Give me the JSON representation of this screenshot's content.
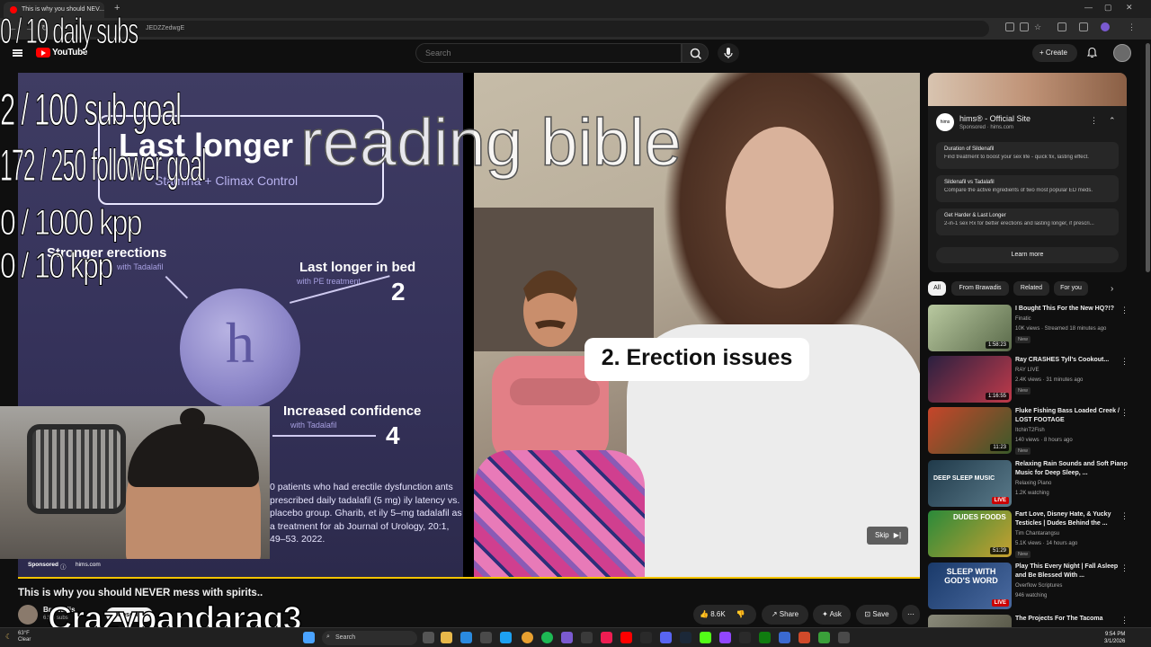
{
  "browser": {
    "tab_title": "This is why you should NEV...",
    "new_tab": "+",
    "url_fragment": "JEDZZedwgE"
  },
  "youtube": {
    "logo_text": "YouTube",
    "search_placeholder": "Search",
    "create_label": "Create"
  },
  "video": {
    "slide_title": "Last longer",
    "slide_subtitle": "Stamina + Climax Control",
    "label_1": "Stronger erections",
    "label_1_sub": "with Tadalafil",
    "label_2": "Last longer in bed",
    "label_2_sub": "with PE treatment",
    "label_2_num": "2",
    "label_3": "Increased confidence",
    "label_3_sub": "with Tadalafil",
    "label_3_num": "4",
    "pill_letter": "h",
    "disclaimer": "0 patients who had erectile dysfunction ants prescribed daily tadalafil (5 mg) ily latency vs. placebo group. Gharib, et ily 5–mg tadalafil as a treatment for ab Journal of Urology, 20:1, 49–53. 2022.",
    "caption": "2. Erection issues",
    "skip_label": "Skip",
    "sponsored_label": "Sponsored",
    "sponsored_site": "hims.com"
  },
  "overlays": {
    "daily_subs": "0 / 10 daily subs",
    "sub_goal": "2  / 100 sub goal",
    "follower_goal": "172 / 250 follower goal",
    "kpp_1000": "0 / 1000 kpp",
    "kpp_10": "0 / 10 kpp",
    "reading": "reading bible",
    "streamer": "Crazypandarag3"
  },
  "below_video": {
    "title": "This is why you should NEVER mess with spirits..",
    "channel": "Brawadis",
    "subs": "6.5M subs",
    "subscribe_label": "Subscribe",
    "likes": "8.6K",
    "share_label": "Share",
    "ask_label": "Ask",
    "save_label": "Save"
  },
  "ad": {
    "title": "hims® - Official Site",
    "sponsored": "Sponsored · hims.com",
    "logo_text": "hims",
    "items": [
      {
        "title": "Duration of Sildenafil",
        "desc": "Find treatment to boost your sex life - quick fix, lasting effect."
      },
      {
        "title": "Sildenafil vs Tadalafil",
        "desc": "Compare the active ingredients of two most popular ED meds."
      },
      {
        "title": "Get Harder & Last Longer",
        "desc": "2-in-1 sex Rx for better erections and lasting longer, if prescri..."
      }
    ],
    "learn_more": "Learn more"
  },
  "chips": [
    "All",
    "From Brawadis",
    "Related",
    "For you"
  ],
  "recommendations": [
    {
      "title": "I Bought This For the New HQ?!?",
      "channel": "Finatic",
      "meta": "10K views · Streamed 18 minutes ago",
      "badge": "New",
      "duration": "1:58:23",
      "thumb_color": "#8a9a6a"
    },
    {
      "title": "Ray CRASHES Tyll's Cookout...",
      "channel": "RAY LIVE",
      "meta": "2.4K views · 31 minutes ago",
      "badge": "New",
      "duration": "1:16:55",
      "thumb_color": "#3a2b4a"
    },
    {
      "title": "Fluke Fishing Bass Loaded Creek / LOST FOOTAGE",
      "channel": "ItchinT2Fish",
      "meta": "140 views · 8 hours ago",
      "badge": "New",
      "duration": "11:23",
      "thumb_color": "#6a4a3a"
    },
    {
      "title": "Relaxing Rain Sounds and Soft Piano Music for Deep Sleep, ...",
      "channel": "Relaxing Piano",
      "meta": "1.2K watching",
      "badge": "",
      "duration": "LIVE",
      "thumb_color": "#2c4a5a",
      "thumb_text": "DEEP SLEEP MUSIC"
    },
    {
      "title": "Fart Love, Disney Hate, & Yucky Testicles | Dudes Behind the ...",
      "channel": "Tim Chantarangsu",
      "meta": "5.1K views · 14 hours ago",
      "badge": "New",
      "duration": "51:29",
      "thumb_color": "#3a7a3a",
      "thumb_text": "DUDES FOODS"
    },
    {
      "title": "Play This Every Night | Fall Asleep and Be Blessed With ...",
      "channel": "Overflow Scriptures",
      "meta": "946 watching",
      "badge": "",
      "duration": "LIVE",
      "thumb_color": "#2a4a7a",
      "thumb_text": "SLEEP WITH GOD'S WORD"
    },
    {
      "title": "The Projects For The Tacoma",
      "channel": "",
      "meta": "",
      "badge": "",
      "duration": "",
      "thumb_color": "#6a6a5a"
    }
  ],
  "taskbar": {
    "temp": "63°F",
    "cond": "Clear",
    "search_label": "Search",
    "time": "9:54 PM",
    "date": "3/1/2026"
  }
}
